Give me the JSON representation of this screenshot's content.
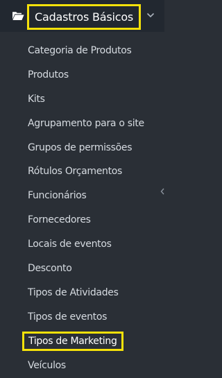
{
  "sidebar": {
    "section": {
      "icon": "folder-open-icon",
      "title": "Cadastros Básicos",
      "chevron": "chevron-down-icon"
    },
    "items": [
      {
        "label": "Categoria de Produtos"
      },
      {
        "label": "Produtos"
      },
      {
        "label": "Kits"
      },
      {
        "label": "Agrupamento para o site"
      },
      {
        "label": "Grupos de permissões"
      },
      {
        "label": "Rótulos Orçamentos"
      },
      {
        "label": "Funcionários"
      },
      {
        "label": "Fornecedores"
      },
      {
        "label": "Locais de eventos"
      },
      {
        "label": "Desconto"
      },
      {
        "label": "Tipos de Atividades"
      },
      {
        "label": "Tipos de eventos"
      },
      {
        "label": "Tipos de Marketing",
        "highlighted": true
      },
      {
        "label": "Veículos"
      }
    ]
  },
  "colors": {
    "background": "#2a2f36",
    "header_background": "#222830",
    "text": "#d6dbe1",
    "highlight_border": "#f5e10a"
  }
}
